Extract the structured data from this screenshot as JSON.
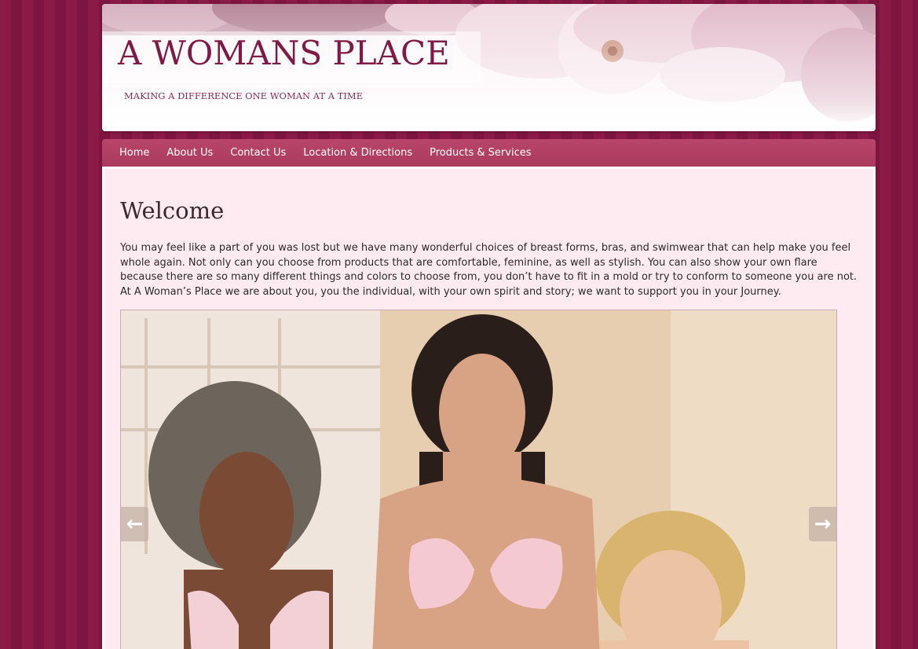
{
  "header": {
    "title": "A WOMANS PLACE",
    "tagline": "MAKING A DIFFERENCE ONE WOMAN AT A TIME"
  },
  "nav": {
    "items": [
      "Home",
      "About Us",
      "Contact Us",
      "Location & Directions",
      "Products & Services"
    ]
  },
  "main": {
    "heading": "Welcome",
    "intro": "You may feel like a part of you was lost but we have many wonderful choices of breast forms, bras, and swimwear that can help make you feel whole again. Not only can you choose from products that are comfortable, feminine, as well as stylish. You can also show your own flare because there are so many different things and colors to choose from, you don’t have to fit in a mold or try to conform to someone you are not. At A Woman’s Place we are about you, you the individual, with your own spirit and story; we want to support you in your Journey."
  },
  "slider": {
    "prev_icon": "arrow-left-icon",
    "next_icon": "arrow-right-icon",
    "prev_glyph": "←",
    "next_glyph": "→"
  },
  "colors": {
    "background": "#8a1a46",
    "nav": "#b9466a",
    "content_bg": "#fdebf1",
    "title": "#7e1a45"
  }
}
